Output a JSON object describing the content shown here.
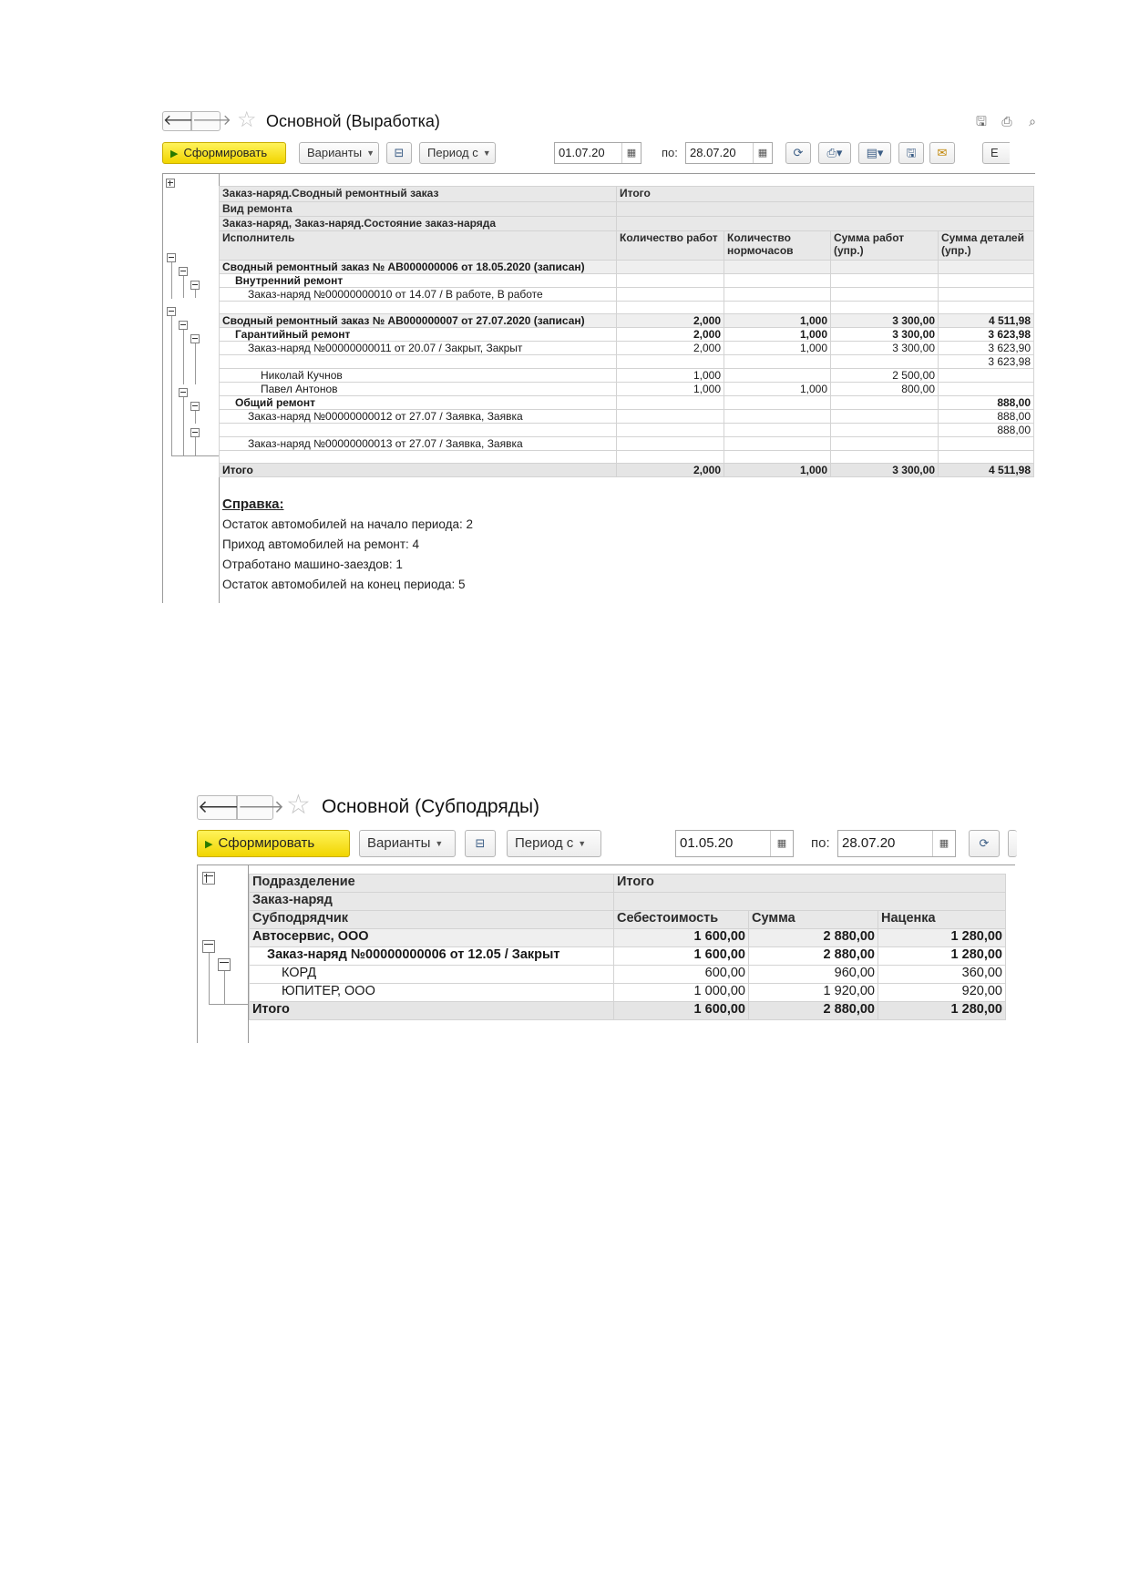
{
  "report1": {
    "title": "Основной (Выработка)",
    "toolbar": {
      "generate_label": "Сформировать",
      "variants_label": "Варианты",
      "period_label": "Период с",
      "date_from": "01.07.20",
      "to_label": "по:",
      "date_to": "28.07.20",
      "more_label": "Е"
    },
    "table": {
      "headers": {
        "g1": "Заказ-наряд.Сводный ремонтный заказ",
        "g2": "Вид ремонта",
        "g3": "Заказ-наряд, Заказ-наряд.Состояние заказ-наряда",
        "g4": "Исполнитель",
        "total": "Итого",
        "col1": "Количество работ",
        "col2": "Количество нормочасов",
        "col3": "Сумма работ (упр.)",
        "col4": "Сумма деталей (упр.)"
      },
      "rows": [
        {
          "name": "Сводный ремонтный заказ № АВ000000006 от 18.05.2020 (записан)",
          "c1": "",
          "c2": "",
          "c3": "",
          "c4": ""
        },
        {
          "name": "Внутренний ремонт",
          "c1": "",
          "c2": "",
          "c3": "",
          "c4": ""
        },
        {
          "name": "Заказ-наряд №00000000010 от 14.07 / В работе, В работе",
          "c1": "",
          "c2": "",
          "c3": "",
          "c4": ""
        },
        {
          "name": "",
          "c1": "",
          "c2": "",
          "c3": "",
          "c4": ""
        },
        {
          "name": "Сводный ремонтный заказ № АВ000000007 от 27.07.2020 (записан)",
          "c1": "2,000",
          "c2": "1,000",
          "c3": "3 300,00",
          "c4": "4 511,98"
        },
        {
          "name": "Гарантийный ремонт",
          "c1": "2,000",
          "c2": "1,000",
          "c3": "3 300,00",
          "c4": "3 623,98"
        },
        {
          "name": "Заказ-наряд №00000000011 от 20.07 / Закрыт, Закрыт",
          "c1": "2,000",
          "c2": "1,000",
          "c3": "3 300,00",
          "c4": "3 623,90"
        },
        {
          "name": "",
          "c1": "",
          "c2": "",
          "c3": "",
          "c4": "3 623,98"
        },
        {
          "name": "Николай Кучнов",
          "c1": "1,000",
          "c2": "",
          "c3": "2 500,00",
          "c4": ""
        },
        {
          "name": "Павел Антонов",
          "c1": "1,000",
          "c2": "1,000",
          "c3": "800,00",
          "c4": ""
        },
        {
          "name": "Общий ремонт",
          "c1": "",
          "c2": "",
          "c3": "",
          "c4": "888,00"
        },
        {
          "name": "Заказ-наряд №00000000012 от 27.07 / Заявка, Заявка",
          "c1": "",
          "c2": "",
          "c3": "",
          "c4": "888,00"
        },
        {
          "name": "",
          "c1": "",
          "c2": "",
          "c3": "",
          "c4": "888,00"
        },
        {
          "name": "Заказ-наряд №00000000013 от 27.07 / Заявка, Заявка",
          "c1": "",
          "c2": "",
          "c3": "",
          "c4": ""
        },
        {
          "name": "",
          "c1": "",
          "c2": "",
          "c3": "",
          "c4": ""
        },
        {
          "name": "Итого",
          "c1": "2,000",
          "c2": "1,000",
          "c3": "3 300,00",
          "c4": "4 511,98"
        }
      ]
    },
    "notes": {
      "heading": "Справка:",
      "line1": "Остаток автомобилей на начало периода: 2",
      "line2": "Приход автомобилей на ремонт: 4",
      "line3": "Отработано машино-заездов: 1",
      "line4": "Остаток автомобилей на конец периода: 5"
    }
  },
  "report2": {
    "title": "Основной (Субподряды)",
    "toolbar": {
      "generate_label": "Сформировать",
      "variants_label": "Варианты",
      "period_label": "Период с",
      "date_from": "01.05.20",
      "to_label": "по:",
      "date_to": "28.07.20"
    },
    "table": {
      "headers": {
        "g1": "Подразделение",
        "g2": "Заказ-наряд",
        "g3": "Субподрядчик",
        "total": "Итого",
        "col1": "Себестоимость",
        "col2": "Сумма",
        "col3": "Наценка"
      },
      "rows": [
        {
          "name": "Автосервис, ООО",
          "c1": "1 600,00",
          "c2": "2 880,00",
          "c3": "1 280,00"
        },
        {
          "name": "Заказ-наряд №00000000006 от 12.05 / Закрыт",
          "c1": "1 600,00",
          "c2": "2 880,00",
          "c3": "1 280,00"
        },
        {
          "name": "КОРД",
          "c1": "600,00",
          "c2": "960,00",
          "c3": "360,00"
        },
        {
          "name": "ЮПИТЕР, ООО",
          "c1": "1 000,00",
          "c2": "1 920,00",
          "c3": "920,00"
        },
        {
          "name": "Итого",
          "c1": "1 600,00",
          "c2": "2 880,00",
          "c3": "1 280,00"
        }
      ]
    }
  }
}
